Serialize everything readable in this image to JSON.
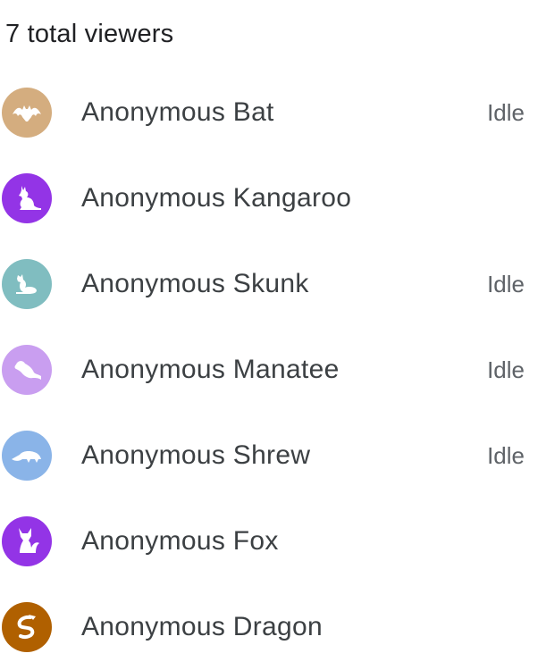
{
  "header": {
    "title": "7 total viewers"
  },
  "viewers": [
    {
      "name": "Anonymous Bat",
      "status": "Idle",
      "icon": "bat-icon",
      "color": "#d4ad7f"
    },
    {
      "name": "Anonymous Kangaroo",
      "status": "",
      "icon": "kangaroo-icon",
      "color": "#9334e6"
    },
    {
      "name": "Anonymous Skunk",
      "status": "Idle",
      "icon": "skunk-icon",
      "color": "#80bdc0"
    },
    {
      "name": "Anonymous Manatee",
      "status": "Idle",
      "icon": "manatee-icon",
      "color": "#c99ef0"
    },
    {
      "name": "Anonymous Shrew",
      "status": "Idle",
      "icon": "shrew-icon",
      "color": "#8ab4e8"
    },
    {
      "name": "Anonymous Fox",
      "status": "",
      "icon": "fox-icon",
      "color": "#9334e6"
    },
    {
      "name": "Anonymous Dragon",
      "status": "",
      "icon": "dragon-icon",
      "color": "#b06000"
    }
  ]
}
